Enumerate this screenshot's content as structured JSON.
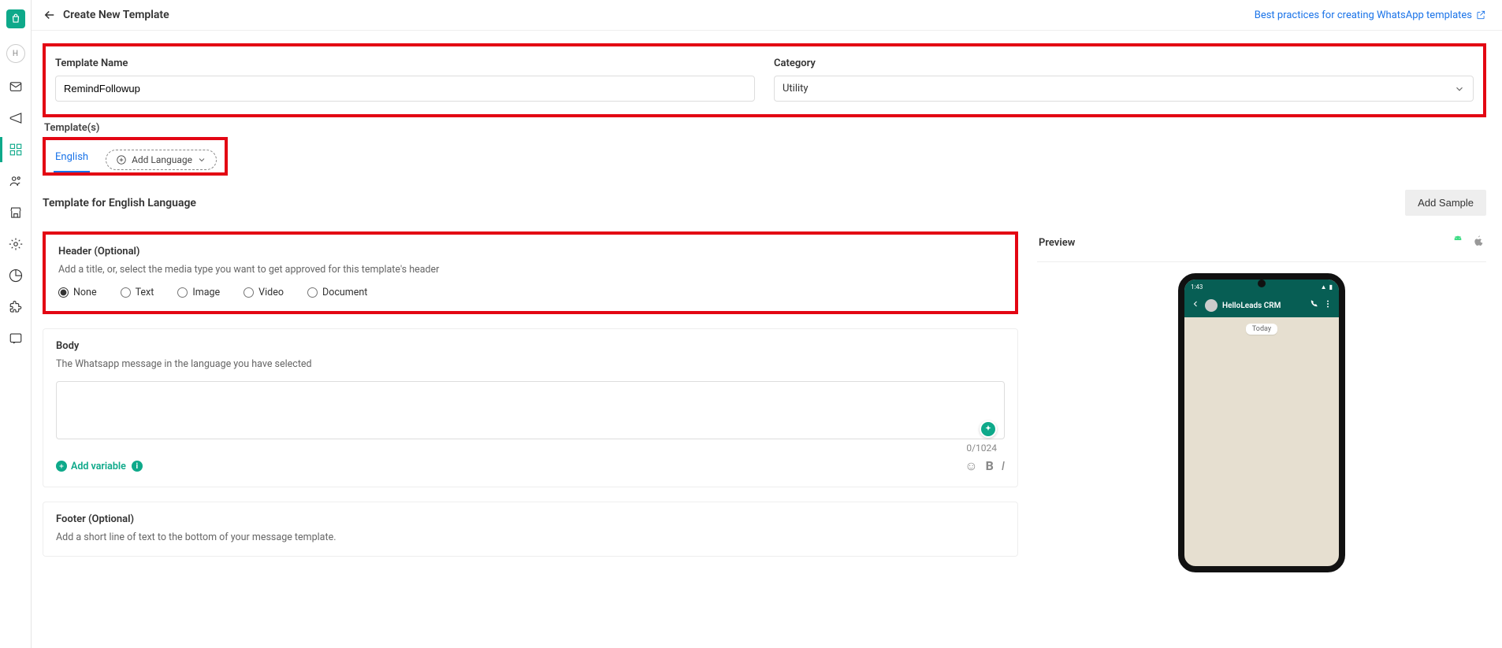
{
  "sidebar": {
    "avatar_initial": "H"
  },
  "header": {
    "title": "Create New Template",
    "best_practices": "Best practices for creating WhatsApp templates"
  },
  "form": {
    "template_name_label": "Template Name",
    "template_name_value": "RemindFollowup",
    "category_label": "Category",
    "category_value": "Utility",
    "templates_label": "Template(s)",
    "lang_tab": "English",
    "add_language": "Add Language"
  },
  "section": {
    "title": "Template for English Language",
    "add_sample": "Add Sample"
  },
  "headerCard": {
    "title": "Header (Optional)",
    "desc": "Add a title, or, select the media type you want to get approved for this template's header",
    "options": {
      "none": "None",
      "text": "Text",
      "image": "Image",
      "video": "Video",
      "document": "Document"
    }
  },
  "bodyCard": {
    "title": "Body",
    "desc": "The Whatsapp message in the language you have selected",
    "counter": "0/1024",
    "add_variable": "Add variable"
  },
  "footerCard": {
    "title": "Footer (Optional)",
    "desc": "Add a short line of text to the bottom of your message template."
  },
  "preview": {
    "label": "Preview",
    "time": "1:43",
    "contact": "HelloLeads CRM",
    "day": "Today"
  }
}
